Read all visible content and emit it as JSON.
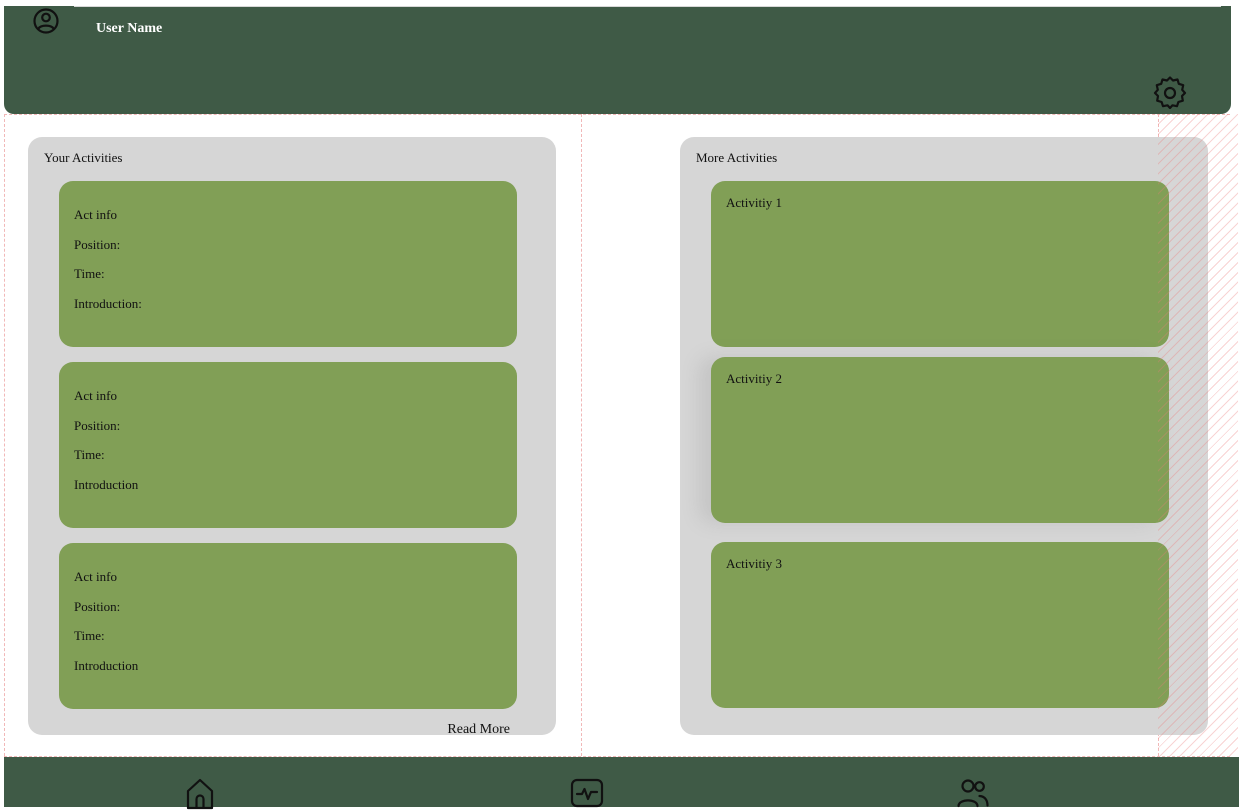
{
  "header": {
    "user_name": "User Name",
    "profile_icon": "user-circle-icon",
    "settings_icon": "gear-icon"
  },
  "your_activities": {
    "title": "Your Activities",
    "cards": [
      {
        "line1": "Act info",
        "line2": "Position:",
        "line3": "Time:",
        "line4": "Introduction:"
      },
      {
        "line1": "Act info",
        "line2": "Position:",
        "line3": "Time:",
        "line4": "Introduction"
      },
      {
        "line1": "Act info",
        "line2": "Position:",
        "line3": "Time:",
        "line4": "Introduction"
      }
    ],
    "read_more": "Read More"
  },
  "more_activities": {
    "title": "More Activities",
    "cards": [
      {
        "title": "Activitiy 1"
      },
      {
        "title": "Activitiy 2"
      },
      {
        "title": "Activitiy 3"
      }
    ]
  },
  "bottom_nav": {
    "items": [
      {
        "icon": "home-icon"
      },
      {
        "icon": "activity-monitor-icon"
      },
      {
        "icon": "users-icon"
      }
    ]
  },
  "colors": {
    "header": "#3f5a46",
    "panel": "#d6d6d6",
    "card": "#819f56",
    "text": "#111111"
  }
}
